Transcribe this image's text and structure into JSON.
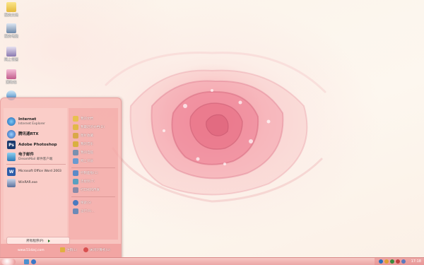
{
  "desktop": {
    "icons": [
      {
        "label": "我的文档",
        "icon": "folder-icon"
      },
      {
        "label": "我的电脑",
        "icon": "computer-icon"
      },
      {
        "label": "网上邻居",
        "icon": "network-icon"
      },
      {
        "label": "回收站",
        "icon": "recycle-bin-icon"
      }
    ]
  },
  "start_menu": {
    "pinned": [
      {
        "title": "Internet",
        "subtitle": "Internet Explorer",
        "icon": "internet-explorer-icon"
      },
      {
        "title": "腾讯通RTX",
        "subtitle": "",
        "icon": "rtx-icon"
      },
      {
        "title": "Adobe Photoshop",
        "subtitle": "",
        "icon": "photoshop-icon"
      },
      {
        "title": "电子邮件",
        "subtitle": "DreamMail 邮件客户端",
        "icon": "email-icon"
      }
    ],
    "recent": [
      {
        "title": "Microsoft Office Word 2003",
        "icon": "word-icon"
      },
      {
        "title": "WinRAR.exe",
        "icon": "winrar-icon"
      }
    ],
    "right": [
      {
        "label": "我的文档",
        "icon": "my-documents-icon"
      },
      {
        "label": "我最近的文档(D)",
        "icon": "recent-documents-icon"
      },
      {
        "label": "图片收藏",
        "icon": "my-pictures-icon"
      },
      {
        "label": "我的音乐",
        "icon": "my-music-icon"
      },
      {
        "label": "我的电脑",
        "icon": "my-computer-icon"
      },
      {
        "label": "网上邻居",
        "icon": "network-places-icon"
      },
      {
        "label": "控制面板(C)",
        "icon": "control-panel-icon"
      },
      {
        "label": "连接到(T)",
        "icon": "connect-to-icon"
      },
      {
        "label": "打印机和传真",
        "icon": "printers-icon"
      },
      {
        "label": "搜索(S)",
        "icon": "search-icon"
      },
      {
        "label": "运行(R)...",
        "icon": "run-icon"
      }
    ],
    "all_programs_label": "所有程序(P)",
    "url": "www.51dzsj.com",
    "logoff_label": "注销(L)",
    "shutdown_label": "关闭计算机(U)"
  },
  "taskbar": {
    "clock": "17:18"
  },
  "colors": {
    "taskbar": "#eaa3a2",
    "start_menu": "#f6b6b2",
    "rose": "#ec7a8e"
  }
}
